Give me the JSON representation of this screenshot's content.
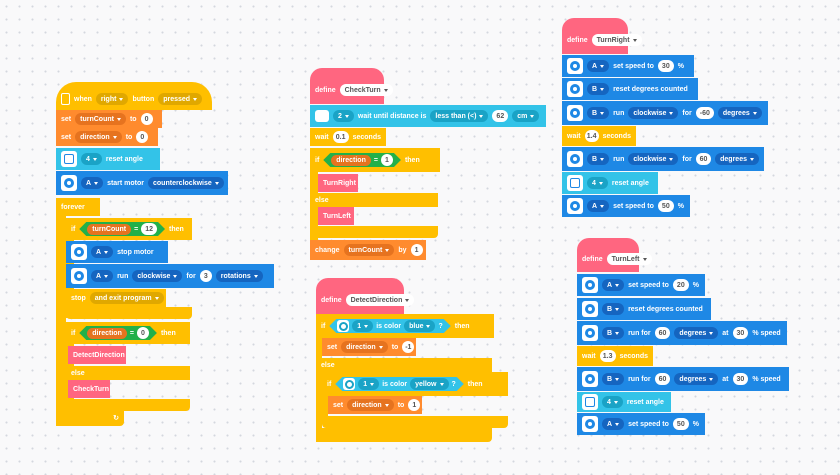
{
  "colors": {
    "events": "#ffbf00",
    "variables": "#ff8b2e",
    "motors": "#1e88e5",
    "sensors": "#33c3e8",
    "myblocks": "#ff6680",
    "operators": "#22b04a"
  },
  "main": {
    "when": "when",
    "when_port": "right",
    "when_button": "button",
    "when_state": "pressed",
    "set1": "set",
    "set1_var": "turnCount",
    "set1_to": "to",
    "set1_val": "0",
    "set2": "set",
    "set2_var": "direction",
    "set2_to": "to",
    "set2_val": "0",
    "reset_port": "4",
    "reset_label": "reset angle",
    "start_port": "A",
    "start_label": "start motor",
    "start_dir": "counterclockwise",
    "forever": "forever",
    "if1": "if",
    "if1_var": "turnCount",
    "if1_op": "=",
    "if1_val": "12",
    "if1_then": "then",
    "stop_port": "A",
    "stop_label": "stop motor",
    "run_port": "A",
    "run": "run",
    "run_dir": "clockwise",
    "run_for": "for",
    "run_val": "3",
    "run_unit": "rotations",
    "stopall": "stop",
    "stopall_opt": "and exit program",
    "if2": "if",
    "if2_var": "direction",
    "if2_op": "=",
    "if2_val": "0",
    "if2_then": "then",
    "call1": "DetectDirection",
    "else": "else",
    "call2": "CheckTurn"
  },
  "checkturn": {
    "define": "define",
    "name": "CheckTurn",
    "wait_port": "2",
    "wait_label": "wait until distance is",
    "wait_op": "less than (<)",
    "wait_val": "62",
    "wait_unit": "cm",
    "wait2": "wait",
    "wait2_val": "0.1",
    "wait2_unit": "seconds",
    "if": "if",
    "var": "direction",
    "op": "=",
    "val": "1",
    "then": "then",
    "call1": "TurnRight",
    "else": "else",
    "call2": "TurnLeft",
    "change": "change",
    "change_var": "turnCount",
    "change_by": "by",
    "change_val": "1"
  },
  "detect": {
    "define": "define",
    "name": "DetectDirection",
    "if1": "if",
    "port1": "1",
    "is_color": "is color",
    "color1": "blue",
    "q": "?",
    "then": "then",
    "set": "set",
    "var": "direction",
    "to": "to",
    "val1": "-1",
    "else": "else",
    "if2": "if",
    "port2": "1",
    "color2": "yellow",
    "val2": "1"
  },
  "turnright": {
    "define": "define",
    "name": "TurnRight",
    "s1_port": "A",
    "s1_label": "set speed to",
    "s1_val": "30",
    "pct": "%",
    "r_port": "B",
    "r_label": "reset degrees counted",
    "run_port": "B",
    "run": "run",
    "run_dir": "clockwise",
    "run_for": "for",
    "run_val": "-60",
    "run_unit": "degrees",
    "wait": "wait",
    "wait_val": "1.4",
    "wait_unit": "seconds",
    "run2_port": "B",
    "run2_val": "60",
    "ra_port": "4",
    "ra_label": "reset angle",
    "s2_port": "A",
    "s2_val": "50"
  },
  "turnleft": {
    "define": "define",
    "name": "TurnLeft",
    "s1_port": "A",
    "s1_label": "set speed to",
    "s1_val": "20",
    "pct": "%",
    "r_port": "B",
    "r_label": "reset degrees counted",
    "rf_port": "B",
    "rf_label": "run for",
    "rf_val": "60",
    "rf_unit": "degrees",
    "rf_at": "at",
    "rf_speed": "30",
    "rf_speed_label": "% speed",
    "wait": "wait",
    "wait_val": "1.3",
    "wait_unit": "seconds",
    "rf2_port": "B",
    "rf2_val": "60",
    "ra_port": "4",
    "ra_label": "reset angle",
    "s2_port": "A",
    "s2_val": "50"
  }
}
